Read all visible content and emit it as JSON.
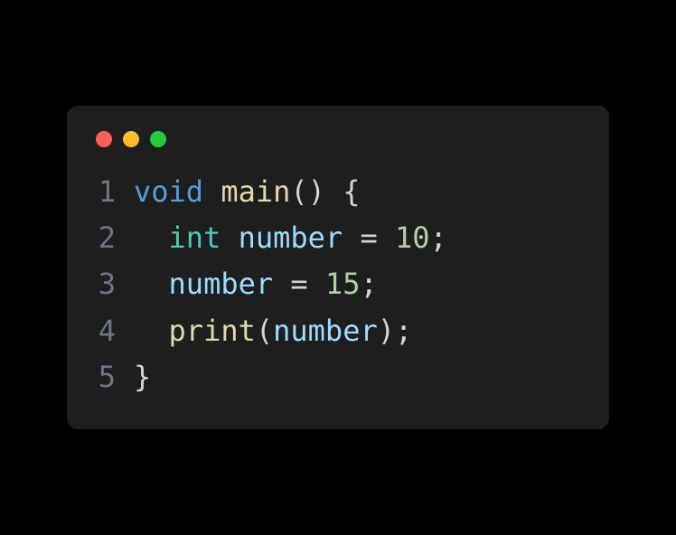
{
  "code": {
    "lines": [
      {
        "number": "1",
        "tokens": [
          {
            "text": "void",
            "type": "keyword"
          },
          {
            "text": " ",
            "type": "punctuation"
          },
          {
            "text": "main",
            "type": "function"
          },
          {
            "text": "()",
            "type": "punctuation"
          },
          {
            "text": " ",
            "type": "punctuation"
          },
          {
            "text": "{",
            "type": "punctuation"
          }
        ]
      },
      {
        "number": "2",
        "tokens": [
          {
            "text": "  ",
            "type": "punctuation"
          },
          {
            "text": "int",
            "type": "type"
          },
          {
            "text": " ",
            "type": "punctuation"
          },
          {
            "text": "number",
            "type": "variable"
          },
          {
            "text": " ",
            "type": "punctuation"
          },
          {
            "text": "=",
            "type": "operator"
          },
          {
            "text": " ",
            "type": "punctuation"
          },
          {
            "text": "10",
            "type": "number"
          },
          {
            "text": ";",
            "type": "punctuation"
          }
        ]
      },
      {
        "number": "3",
        "tokens": [
          {
            "text": "  ",
            "type": "punctuation"
          },
          {
            "text": "number",
            "type": "variable"
          },
          {
            "text": " ",
            "type": "punctuation"
          },
          {
            "text": "=",
            "type": "operator"
          },
          {
            "text": " ",
            "type": "punctuation"
          },
          {
            "text": "15",
            "type": "number"
          },
          {
            "text": ";",
            "type": "punctuation"
          }
        ]
      },
      {
        "number": "4",
        "tokens": [
          {
            "text": "  ",
            "type": "punctuation"
          },
          {
            "text": "print",
            "type": "function"
          },
          {
            "text": "(",
            "type": "punctuation"
          },
          {
            "text": "number",
            "type": "variable"
          },
          {
            "text": ")",
            "type": "punctuation"
          },
          {
            "text": ";",
            "type": "punctuation"
          }
        ]
      },
      {
        "number": "5",
        "tokens": [
          {
            "text": "}",
            "type": "punctuation"
          }
        ]
      }
    ]
  }
}
